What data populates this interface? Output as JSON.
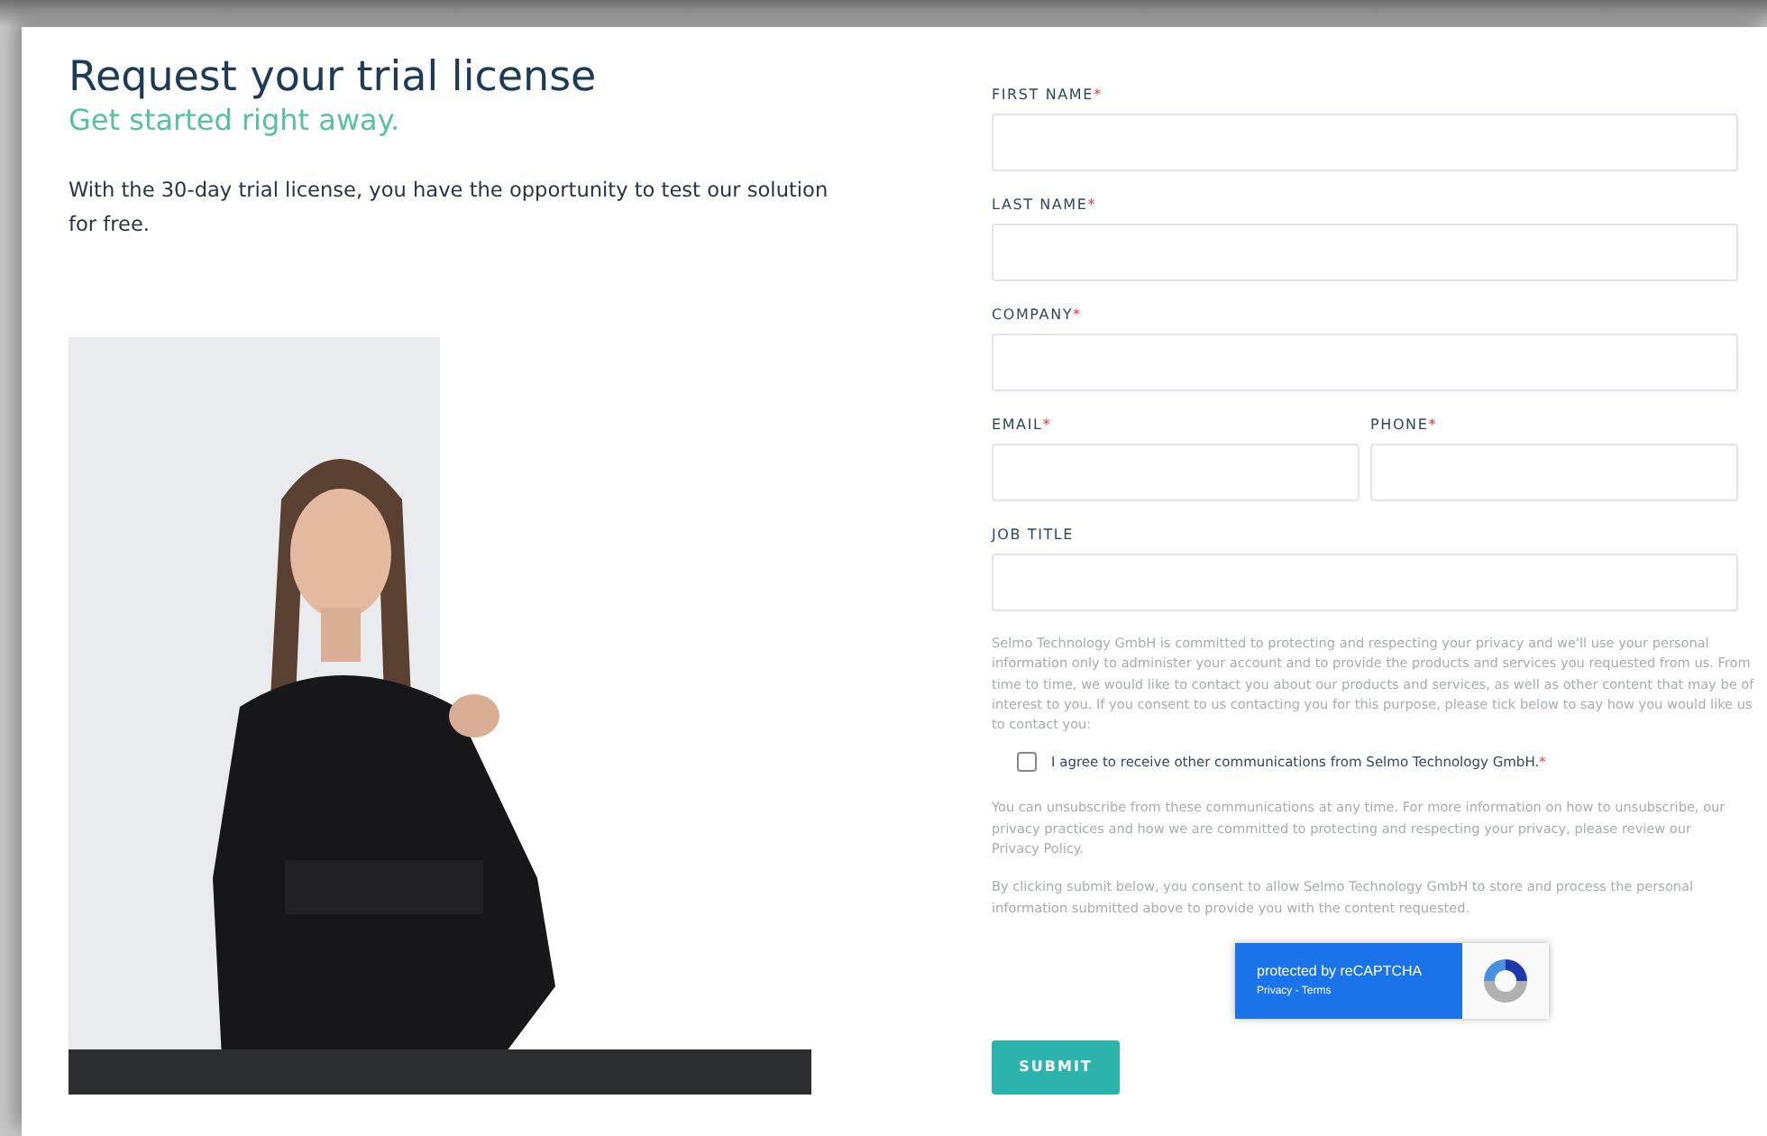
{
  "heading": {
    "title": "Request your trial license",
    "subtitle": "Get started right away.",
    "intro": "With the 30-day trial license, you have the opportunity to test our solution for free."
  },
  "form": {
    "rows": [
      {
        "fields": [
          {
            "label": "FIRST NAME",
            "mark": "*"
          }
        ]
      },
      {
        "fields": [
          {
            "label": "LAST NAME",
            "mark": "*"
          }
        ]
      },
      {
        "fields": [
          {
            "label": "COMPANY",
            "mark": "*"
          }
        ]
      },
      {
        "fields": [
          {
            "label": "EMAIL",
            "mark": "*"
          },
          {
            "label": "PHONE",
            "mark": "*"
          }
        ]
      },
      {
        "fields": [
          {
            "label": "JOB TITLE"
          }
        ]
      }
    ],
    "privacy_text": "Selmo Technology GmbH is committed to protecting and respecting your privacy and we'll use your personal information only to administer your account and to provide the products and services you requested from us. From time to time, we would like to contact you about our products and services, as well as other content that may be of interest to you. If you consent to us contacting you for this purpose, please tick below to say how you would like us to contact you:",
    "consent": {
      "label": "I agree to receive other communications from Selmo Technology GmbH.",
      "mark": "*",
      "checked": false
    },
    "unsubscribe_text": "You can unsubscribe from these communications at any time. For more information on how to unsubscribe, our privacy practices and how we are committed to protecting and respecting your privacy, please review our Privacy Policy.",
    "submit_text": "By clicking submit below, you consent to allow Selmo Technology GmbH to store and process the personal information submitted above to provide you with the content requested.",
    "recaptcha": {
      "title": "protected by reCAPTCHA",
      "links": "Privacy - Terms"
    },
    "submit": "SUBMIT"
  }
}
